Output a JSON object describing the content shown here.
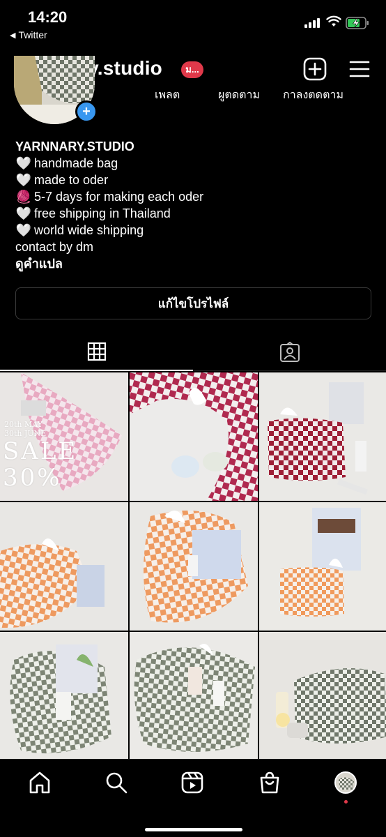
{
  "status_bar": {
    "time": "14:20",
    "back_app": "Twitter",
    "back_icon": "left-triangle-icon",
    "icons": [
      "signal-icon",
      "wifi-icon",
      "battery-charging-icon"
    ]
  },
  "header": {
    "username": "yarnnary.studio",
    "badge": "ม...",
    "new_post_icon": "plus-square-icon",
    "menu_icon": "hamburger-menu-icon"
  },
  "stats": {
    "posts_label": "เพลต",
    "followers_label": "ผูตดตาม",
    "following_label": "กาลงตดตาม"
  },
  "bio": {
    "name": "YARNNARY.STUDIO",
    "lines": [
      {
        "emoji": "🤍",
        "text": "handmade bag"
      },
      {
        "emoji": "🤍",
        "text": "made to oder"
      },
      {
        "emoji": "🧶",
        "text": "5-7 days for making each oder"
      },
      {
        "emoji": "🤍",
        "text": "free shipping in Thailand"
      },
      {
        "emoji": "🤍",
        "text": "world wide shipping"
      }
    ],
    "contact": "contact by dm",
    "translate": "ดูคำแปล"
  },
  "edit_profile_button": "แก้ไขโปรไฟล์",
  "tabs": {
    "grid_icon": "grid-icon",
    "tagged_icon": "tagged-person-icon"
  },
  "posts": [
    {
      "sale_dates_1": "20th MAY -",
      "sale_dates_2": "30th JUNE",
      "sale_title": "SALE",
      "sale_percent": "30%",
      "bag_color": "#e8a9c1"
    },
    {
      "bag_color": "#b0294f"
    },
    {
      "bag_color": "#9e1e36"
    },
    {
      "bag_color": "#ee9a60"
    },
    {
      "bag_color": "#ee9a60"
    },
    {
      "bag_color": "#f09a5c"
    },
    {
      "bag_color": "#7d8575"
    },
    {
      "bag_color": "#7d8575"
    },
    {
      "bag_color": "#6f776a"
    }
  ],
  "bottom_nav": {
    "items": [
      "home-icon",
      "search-icon",
      "reels-icon",
      "shop-icon",
      "profile-avatar"
    ]
  },
  "colors": {
    "background": "#000000",
    "accent_blue": "#3897f0",
    "badge_red": "#e0394a"
  }
}
